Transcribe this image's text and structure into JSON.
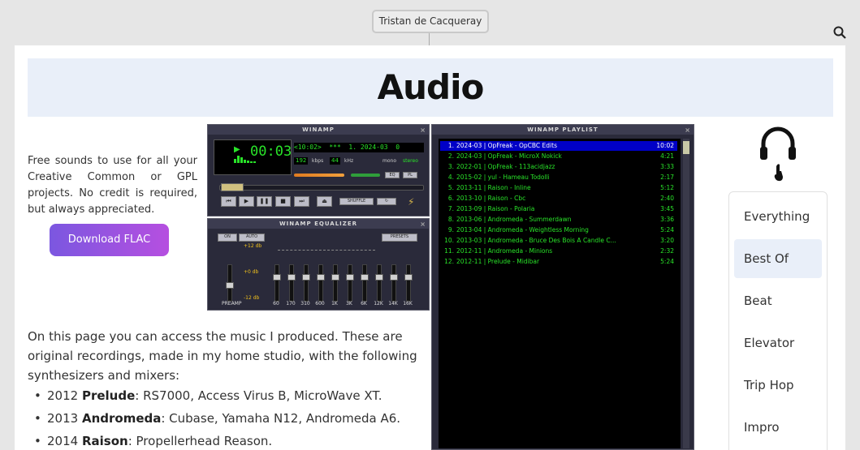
{
  "site": {
    "name": "Tristan de Cacqueray"
  },
  "icons": {
    "search": "search-icon",
    "headphones": "headphones-icon"
  },
  "header": {
    "title": "Audio"
  },
  "intro": {
    "text": "Free sounds to use for all your Creative Common or GPL projects. No credit is required, but always appreciated."
  },
  "download": {
    "label": "Download FLAC"
  },
  "winamp": {
    "main_title": "WINAMP",
    "eq_title": "WINAMP EQUALIZER",
    "playlist_title": "WINAMP PLAYLIST",
    "time": "00:03",
    "marquee": "<10:02>  ***  1. 2024-03  0",
    "kbps_value": "192",
    "kbps_label": "kbps",
    "khz_value": "44",
    "khz_label": "kHz",
    "mono_label": "mono",
    "stereo_label": "stereo",
    "eq_button": "EQ",
    "pl_button": "PL",
    "shuffle_label": "SHUFFLE",
    "eq_on": "ON",
    "eq_auto": "AUTO",
    "eq_presets": "PRESETS",
    "db_plus": "+12 db",
    "db_zero": "+0 db",
    "db_minus": "-12 db",
    "preamp_label": "PREAMP",
    "bands": [
      "60",
      "170",
      "310",
      "600",
      "1K",
      "3K",
      "6K",
      "12K",
      "14K",
      "16K"
    ],
    "playlist": [
      {
        "num": "1.",
        "title": "2024-03 | OpFreak - OpCBC Edits",
        "duration": "10:02",
        "selected": true
      },
      {
        "num": "2.",
        "title": "2024-03 | OpFreak - MicroX Nokick",
        "duration": "4:21"
      },
      {
        "num": "3.",
        "title": "2022-01 | OpFreak - 113acidjazz",
        "duration": "3:33"
      },
      {
        "num": "4.",
        "title": "2015-02 | yul - Hameau Todolli",
        "duration": "2:17"
      },
      {
        "num": "5.",
        "title": "2013-11 | Raison - Inline",
        "duration": "5:12"
      },
      {
        "num": "6.",
        "title": "2013-10 | Raison - Cbc",
        "duration": "2:40"
      },
      {
        "num": "7.",
        "title": "2013-09 | Raison - Polaria",
        "duration": "3:45"
      },
      {
        "num": "8.",
        "title": "2013-06 | Andromeda - Summerdawn",
        "duration": "3:36"
      },
      {
        "num": "9.",
        "title": "2013-04 | Andromeda - Weightless Morning",
        "duration": "5:24"
      },
      {
        "num": "10.",
        "title": "2013-03 | Andromeda - Bruce Des Bois A Candle C...",
        "duration": "3:20"
      },
      {
        "num": "11.",
        "title": "2012-11 | Andromeda - Minions",
        "duration": "2:32"
      },
      {
        "num": "12.",
        "title": "2012-11 | Prelude - Midibar",
        "duration": "5:24"
      }
    ]
  },
  "description": {
    "text": "On this page you can access the music I produced. These are original recordings, made in my home studio, with the following synthesizers and mixers:"
  },
  "gear": [
    {
      "year": "2012",
      "name": "Prelude",
      "items": ": RS7000, Access Virus B, MicroWave XT."
    },
    {
      "year": "2013",
      "name": "Andromeda",
      "items": ": Cubase, Yamaha N12, Andromeda A6."
    },
    {
      "year": "2014",
      "name": "Raison",
      "items": ": Propellerhead Reason."
    }
  ],
  "categories": [
    {
      "label": "Everything",
      "active": false
    },
    {
      "label": "Best Of",
      "active": true
    },
    {
      "label": "Beat",
      "active": false
    },
    {
      "label": "Elevator",
      "active": false
    },
    {
      "label": "Trip Hop",
      "active": false
    },
    {
      "label": "Impro",
      "active": false
    }
  ],
  "colors": {
    "accent_start": "#7b57e0",
    "accent_end": "#b64fe0",
    "title_bg": "#e9eff9",
    "lcd_green": "#29e329",
    "playlist_selected": "#0000c6"
  }
}
